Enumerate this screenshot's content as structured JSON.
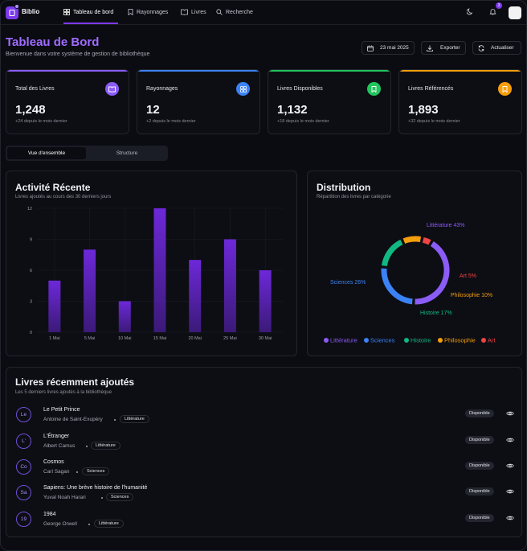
{
  "nav": {
    "brand": "Biblio",
    "links": [
      {
        "label": "Tableau de bord",
        "icon": "grid-icon",
        "active": true
      },
      {
        "label": "Rayonnages",
        "icon": "bookmark-icon",
        "active": false
      },
      {
        "label": "Livres",
        "icon": "book-open-icon",
        "active": false
      },
      {
        "label": "Recherche",
        "icon": "search-icon",
        "active": false
      }
    ],
    "notification_count": "3"
  },
  "header": {
    "title": "Tableau de Bord",
    "subtitle": "Bienvenue dans votre système de gestion de bibliothèque",
    "date_label": "23 mai 2025",
    "export_label": "Exporter",
    "refresh_label": "Actualiser"
  },
  "stats": [
    {
      "label": "Total des Livres",
      "value": "1,248",
      "delta": "+24 depuis le mois dernier",
      "color": "#8b5cf6",
      "icon": "book-icon"
    },
    {
      "label": "Rayonnages",
      "value": "12",
      "delta": "+2 depuis le mois dernier",
      "color": "#3b82f6",
      "icon": "grid-icon"
    },
    {
      "label": "Livres Disponibles",
      "value": "1,132",
      "delta": "+18 depuis le mois dernier",
      "color": "#22c55e",
      "icon": "bookmark-icon"
    },
    {
      "label": "Livres Référencés",
      "value": "1,893",
      "delta": "+32 depuis le mois dernier",
      "color": "#f59e0b",
      "icon": "bookmark-icon"
    }
  ],
  "tabs": [
    "Vue d'ensemble",
    "Structure"
  ],
  "activity": {
    "title": "Activité Récente",
    "subtitle": "Livres ajoutés au cours des 30 derniers jours"
  },
  "distribution": {
    "title": "Distribution",
    "subtitle": "Répartition des livres par catégorie"
  },
  "chart_data": [
    {
      "type": "bar",
      "title": "Activité Récente",
      "categories": [
        "1 Mai",
        "5 Mai",
        "10 Mai",
        "15 Mai",
        "20 Mai",
        "25 Mai",
        "30 Mai"
      ],
      "values": [
        5,
        8,
        3,
        12,
        7,
        9,
        6
      ],
      "yticks": [
        0,
        3,
        6,
        9,
        12
      ],
      "ylim": [
        0,
        12
      ],
      "grid": true,
      "color": "#6d28d9"
    },
    {
      "type": "pie",
      "title": "Distribution",
      "slices": [
        {
          "name": "Littérature",
          "value": 43,
          "color": "#8b5cf6",
          "label": "Littérature 43%"
        },
        {
          "name": "Sciences",
          "value": 26,
          "color": "#3b82f6",
          "label": "Sciences 26%"
        },
        {
          "name": "Histoire",
          "value": 17,
          "color": "#10b981",
          "label": "Histoire 17%"
        },
        {
          "name": "Philosophie",
          "value": 10,
          "color": "#f59e0b",
          "label": "Philosophie 10%"
        },
        {
          "name": "Art",
          "value": 5,
          "color": "#ef4444",
          "label": "Art 5%"
        }
      ]
    }
  ],
  "recent": {
    "title": "Livres récemment ajoutés",
    "subtitle": "Les 5 derniers livres ajoutés à la bibliothèque",
    "books": [
      {
        "initials": "Le",
        "title": "Le Petit Prince",
        "author": "Antoine de Saint-Exupéry",
        "category": "Littérature",
        "status": "Disponible"
      },
      {
        "initials": "L'",
        "title": "L'Étranger",
        "author": "Albert Camus",
        "category": "Littérature",
        "status": "Disponible"
      },
      {
        "initials": "Co",
        "title": "Cosmos",
        "author": "Carl Sagan",
        "category": "Sciences",
        "status": "Disponible"
      },
      {
        "initials": "Sa",
        "title": "Sapiens: Une brève histoire de l'humanité",
        "author": "Yuval Noah Harari",
        "category": "Sciences",
        "status": "Disponible"
      },
      {
        "initials": "19",
        "title": "1984",
        "author": "George Orwell",
        "category": "Littérature",
        "status": "Disponible"
      }
    ]
  }
}
